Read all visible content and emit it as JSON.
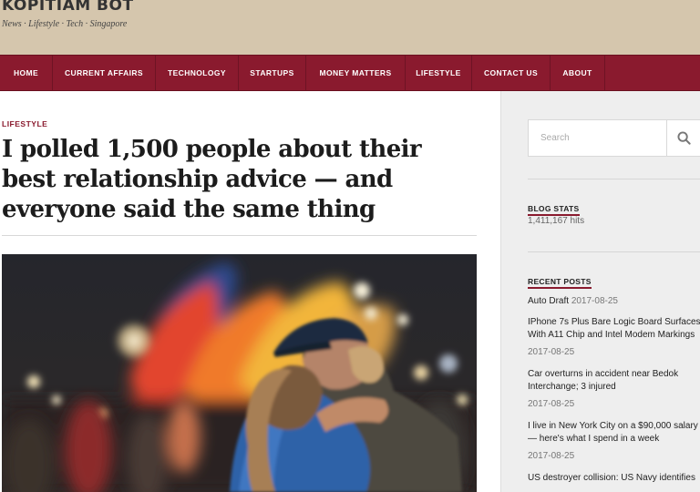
{
  "site": {
    "title": "KOPITIAM BOT",
    "tagline": "News · Lifestyle · Tech · Singapore"
  },
  "nav": {
    "items": [
      {
        "label": "HOME"
      },
      {
        "label": "CURRENT AFFAIRS"
      },
      {
        "label": "TECHNOLOGY"
      },
      {
        "label": "STARTUPS"
      },
      {
        "label": "MONEY MATTERS"
      },
      {
        "label": "LIFESTYLE"
      },
      {
        "label": "CONTACT US"
      },
      {
        "label": "ABOUT"
      }
    ]
  },
  "post": {
    "category": "LIFESTYLE",
    "title": "I polled 1,500 people about their best relationship advice — and everyone said the same thing"
  },
  "sidebar": {
    "search": {
      "placeholder": "Search",
      "icon": "search-icon"
    },
    "blog_stats": {
      "title": "BLOG STATS",
      "value": "1,411,167 hits"
    },
    "recent_posts": {
      "title": "RECENT POSTS",
      "items": [
        {
          "title": "Auto Draft",
          "date": "2017-08-25"
        },
        {
          "title": "IPhone 7s Plus Bare Logic Board Surfaces With A11 Chip and Intel Modem Markings",
          "date": "2017-08-25"
        },
        {
          "title": "Car overturns in accident near Bedok Interchange; 3 injured",
          "date": "2017-08-25"
        },
        {
          "title": "I live in New York City on a $90,000 salary — here's what I spend in a week",
          "date": "2017-08-25"
        },
        {
          "title": "US destroyer collision: US Navy identifies",
          "date": ""
        }
      ]
    }
  },
  "colors": {
    "header_bg": "#d5c6ad",
    "nav_bg": "#8a1a2e",
    "accent": "#8a1a2e",
    "sidebar_bg": "#eeeeee"
  }
}
